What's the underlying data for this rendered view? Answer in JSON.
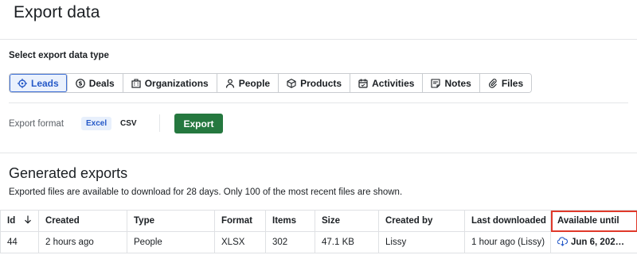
{
  "page": {
    "title": "Export data"
  },
  "data_type": {
    "label": "Select export data type",
    "tabs": [
      {
        "label": "Leads",
        "icon": "target-icon",
        "active": true
      },
      {
        "label": "Deals",
        "icon": "dollar-icon",
        "active": false
      },
      {
        "label": "Organizations",
        "icon": "building-icon",
        "active": false
      },
      {
        "label": "People",
        "icon": "person-icon",
        "active": false
      },
      {
        "label": "Products",
        "icon": "box-icon",
        "active": false
      },
      {
        "label": "Activities",
        "icon": "calendar-icon",
        "active": false
      },
      {
        "label": "Notes",
        "icon": "note-icon",
        "active": false
      },
      {
        "label": "Files",
        "icon": "paperclip-icon",
        "active": false
      }
    ]
  },
  "format": {
    "label": "Export format",
    "options": [
      "Excel",
      "CSV"
    ],
    "selected": "Excel",
    "export_button": "Export"
  },
  "generated": {
    "title": "Generated exports",
    "description": "Exported files are available to download for 28 days. Only 100 of the most recent files are shown.",
    "columns": [
      "Id",
      "Created",
      "Type",
      "Format",
      "Items",
      "Size",
      "Created by",
      "Last downloaded",
      "Available until"
    ],
    "rows": [
      {
        "id": "44",
        "created": "2 hours ago",
        "type": "People",
        "format": "XLSX",
        "items": "302",
        "size": "47.1 KB",
        "created_by": "Lissy",
        "last_downloaded": "1 hour ago (Lissy)",
        "available_until": "Jun 6, 202…"
      }
    ]
  },
  "colors": {
    "accent": "#2559c8",
    "export_button": "#25783f",
    "highlight": "#e0392a"
  }
}
